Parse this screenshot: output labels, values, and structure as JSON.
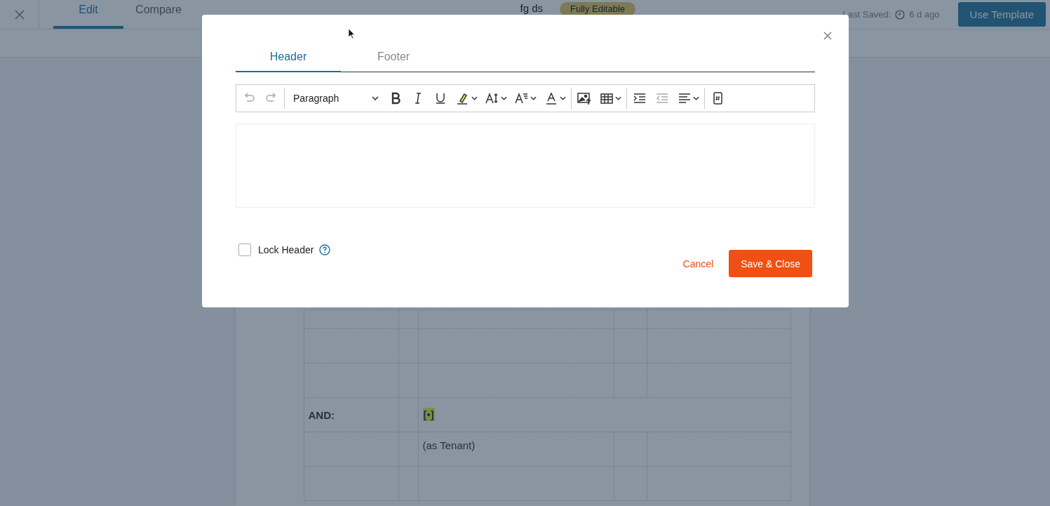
{
  "top_bar": {
    "tabs": [
      {
        "label": "Edit",
        "selected": true
      },
      {
        "label": "Compare",
        "selected": false
      }
    ],
    "document_title": "fg ds",
    "status_badge": "Fully Editable",
    "last_saved_label": "Last Saved:",
    "last_saved_time": "6 d ago",
    "action_button": "Use Template"
  },
  "document": {
    "party_rows": [
      {
        "label": "AND:",
        "value": "[•]",
        "highlighted": true
      },
      {
        "value": "(as Tenant)",
        "highlighted": false
      }
    ]
  },
  "dialog": {
    "tabs": [
      {
        "label": "Header",
        "selected": true
      },
      {
        "label": "Footer",
        "selected": false
      }
    ],
    "toolbar": [
      {
        "kind": "undo",
        "disabled": true
      },
      {
        "kind": "redo",
        "disabled": true
      },
      {
        "kind": "separator"
      },
      {
        "kind": "block-format",
        "label": "Paragraph"
      },
      {
        "kind": "bold",
        "disabled": false
      },
      {
        "kind": "italic",
        "disabled": false
      },
      {
        "kind": "underline",
        "disabled": false
      },
      {
        "kind": "highlight",
        "disabled": false,
        "menu": true
      },
      {
        "kind": "font-size",
        "disabled": false,
        "menu": true
      },
      {
        "kind": "text-style",
        "disabled": false,
        "menu": true
      },
      {
        "kind": "font-color",
        "disabled": false,
        "menu": true
      },
      {
        "kind": "separator"
      },
      {
        "kind": "image",
        "disabled": false
      },
      {
        "kind": "table",
        "disabled": false,
        "menu": true
      },
      {
        "kind": "separator"
      },
      {
        "kind": "indent",
        "disabled": false
      },
      {
        "kind": "outdent",
        "disabled": true
      },
      {
        "kind": "align",
        "disabled": false,
        "menu": true
      },
      {
        "kind": "separator"
      },
      {
        "kind": "page-number",
        "disabled": false
      }
    ],
    "lock": {
      "label": "Lock Header",
      "checked": false
    },
    "cancel": "Cancel",
    "save": "Save & Close"
  }
}
